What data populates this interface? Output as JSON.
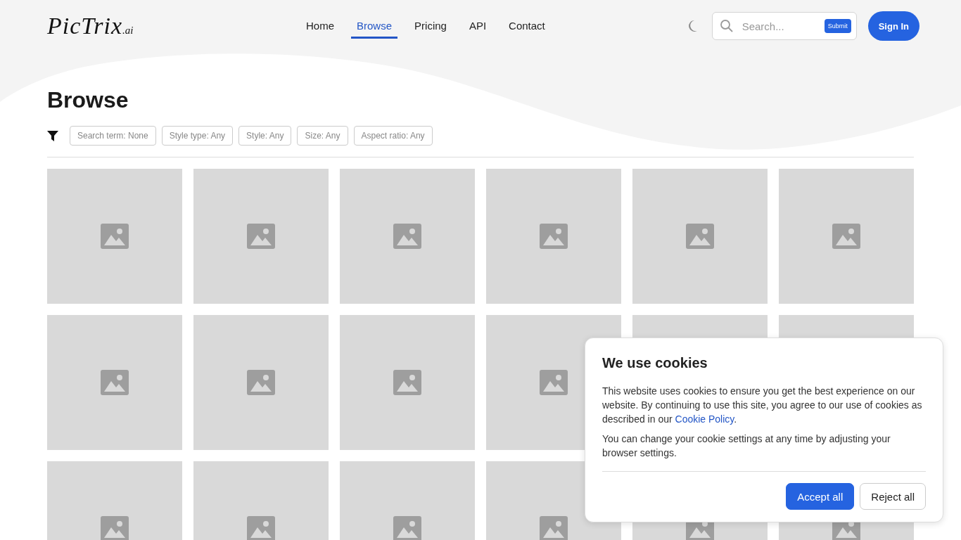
{
  "logo": {
    "name": "PicTrix",
    "suffix": ".ai"
  },
  "nav": [
    {
      "label": "Home",
      "selected": false
    },
    {
      "label": "Browse",
      "selected": true
    },
    {
      "label": "Pricing",
      "selected": false
    },
    {
      "label": "API",
      "selected": false
    },
    {
      "label": "Contact",
      "selected": false
    }
  ],
  "search": {
    "placeholder": "Search...",
    "submit": "Submit"
  },
  "sign_in": "Sign In",
  "page_title": "Browse",
  "filters": [
    "Search term: None",
    "Style type: Any",
    "Style: Any",
    "Size: Any",
    "Aspect ratio: Any"
  ],
  "tiles": [
    {
      "kind": "placeholder"
    },
    {
      "kind": "placeholder"
    },
    {
      "kind": "placeholder"
    },
    {
      "kind": "placeholder"
    },
    {
      "kind": "placeholder"
    },
    {
      "kind": "placeholder"
    },
    {
      "kind": "placeholder"
    },
    {
      "kind": "placeholder"
    },
    {
      "kind": "placeholder"
    },
    {
      "kind": "placeholder"
    },
    {
      "kind": "covered"
    },
    {
      "kind": "covered"
    },
    {
      "kind": "placeholder"
    },
    {
      "kind": "placeholder"
    },
    {
      "kind": "placeholder"
    },
    {
      "kind": "placeholder"
    },
    {
      "kind": "placeholder"
    },
    {
      "kind": "placeholder"
    }
  ],
  "cookie_banner": {
    "title": "We use cookies",
    "text": "This website uses cookies to ensure you get the best experience on our website. By continuing to use this site, you agree to our use of cookies as described in our",
    "link": "Cookie Policy",
    "link_end": ".",
    "text_2": "You can change your cookie settings at any time by adjusting your browser settings.",
    "buttons": [
      {
        "label": "Accept all",
        "kind": "primary"
      },
      {
        "label": "Reject all",
        "kind": "secondary"
      }
    ]
  }
}
